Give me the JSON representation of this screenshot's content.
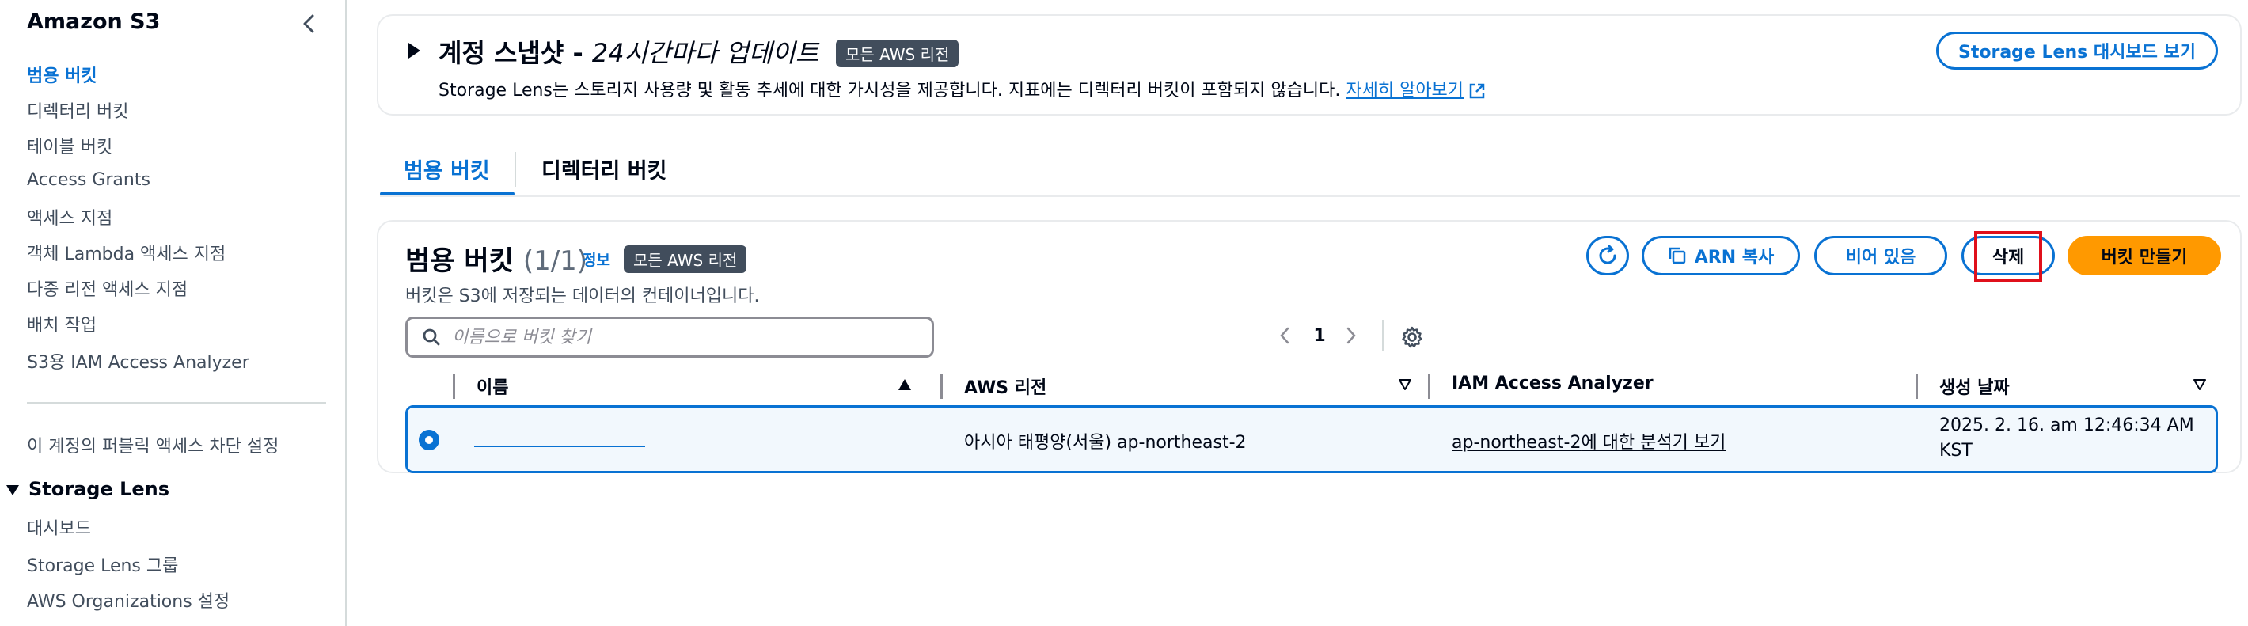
{
  "sidebar": {
    "title": "Amazon S3",
    "items": [
      {
        "label": "범용 버킷"
      },
      {
        "label": "디렉터리 버킷"
      },
      {
        "label": "테이블 버킷"
      },
      {
        "label": "Access Grants"
      },
      {
        "label": "액세스 지점"
      },
      {
        "label": "객체 Lambda 액세스 지점"
      },
      {
        "label": "다중 리전 액세스 지점"
      },
      {
        "label": "배치 작업"
      },
      {
        "label": "S3용 IAM Access Analyzer"
      }
    ],
    "block_public": "이 계정의 퍼블릭 액세스 차단 설정",
    "storage_lens": {
      "label": "Storage Lens",
      "items": [
        {
          "label": "대시보드"
        },
        {
          "label": "Storage Lens 그룹"
        },
        {
          "label": "AWS Organizations 설정"
        }
      ]
    }
  },
  "snapshot": {
    "title_bold": "계정 스냅샷 - ",
    "title_italic": "24시간마다 업데이트",
    "badge": "모든 AWS 리전",
    "desc_a": "Storage Lens",
    "desc_b": "는 스토리지 사용량 및 활동 추세에 대한 가시성을 제공합니다. 지표에는 디렉터리 버킷이 포함되지 않습니다. ",
    "learn_more": "자세히 알아보기",
    "button": "Storage Lens 대시보드 보기"
  },
  "tabs": [
    {
      "label": "범용 버킷"
    },
    {
      "label": "디렉터리 버킷"
    }
  ],
  "buckets": {
    "title": "범용 버킷",
    "count": "(1/1)",
    "info": "정보",
    "badge": "모든 AWS 리전",
    "desc": "버킷은 S3에 저장되는 데이터의 컨테이너입니다.",
    "buttons": {
      "arn": "ARN 복사",
      "empty": "비어 있음",
      "delete": "삭제",
      "create": "버킷 만들기"
    },
    "search_placeholder": "이름으로 버킷 찾기",
    "pagination": {
      "page": "1"
    },
    "columns": [
      "이름",
      "AWS 리전",
      "IAM Access Analyzer",
      "생성 날짜"
    ],
    "rows": [
      {
        "name": "",
        "region": "아시아 태평양(서울) ap-northeast-2",
        "analyzer_region": "ap-northeast-2",
        "analyzer_suffix": "에 대한 분석기 보기",
        "created_line1": "2025. 2. 16. am 12:46:34 AM",
        "created_line2": "KST",
        "selected": true
      }
    ]
  },
  "colors": {
    "accent": "#0972d3",
    "primary_button": "#ff9900",
    "badge_bg": "#414d5c",
    "highlight": "#e0101b"
  }
}
